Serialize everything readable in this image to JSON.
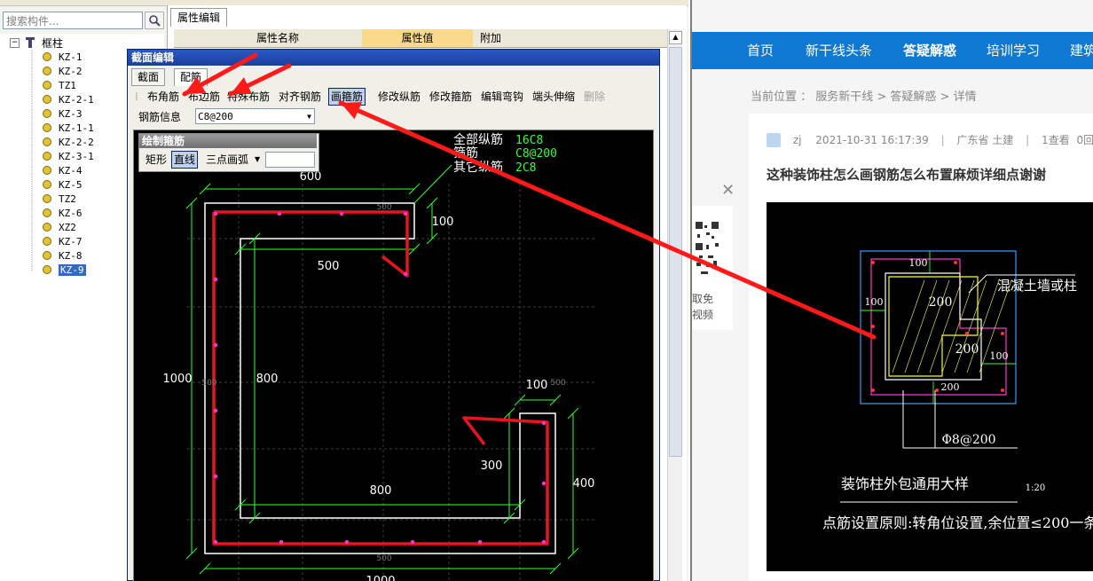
{
  "left_app": {
    "search_placeholder": "搜索构件...",
    "tree_root": "框柱",
    "tree_items": [
      "KZ-1",
      "KZ-2",
      "TZ1",
      "KZ-2-1",
      "KZ-3",
      "KZ-1-1",
      "KZ-2-2",
      "KZ-3-1",
      "KZ-4",
      "KZ-5",
      "TZ2",
      "KZ-6",
      "XZ2",
      "KZ-7",
      "KZ-8",
      "KZ-9"
    ],
    "selected_item": "KZ-9",
    "prop_tab": "属性编辑",
    "prop_col_name": "属性名称",
    "prop_col_value": "属性值",
    "prop_col_extra": "附加"
  },
  "dialog": {
    "title": "截面编辑",
    "tabs": [
      "截面",
      "配筋"
    ],
    "toolbar": [
      "布角筋",
      "布边筋",
      "特殊布筋",
      "对齐钢筋",
      "画箍筋",
      "修改纵筋",
      "修改箍筋",
      "编辑弯钩",
      "端头伸缩",
      "删除"
    ],
    "active_tool": "画箍筋",
    "rebar_info_label": "钢筋信息",
    "rebar_info_value": "C8@200",
    "draw_panel_title": "绘制箍筋",
    "draw_modes": [
      "矩形",
      "直线",
      "三点画弧"
    ],
    "active_mode": "直线",
    "legend_labels": [
      "全部纵筋",
      "箍筋",
      "其它纵筋"
    ],
    "legend_values": [
      "16C8",
      "C8@200",
      "2C8"
    ],
    "dims": [
      "600",
      "100",
      "500",
      "1000",
      "800",
      "100",
      "300",
      "800",
      "400",
      "1000"
    ],
    "faint_dims": [
      "500",
      "500",
      "500",
      "500"
    ]
  },
  "web": {
    "nav": [
      "首页",
      "新干线头条",
      "答疑解惑",
      "培训学习",
      "建筑"
    ],
    "active_nav": "答疑解惑",
    "breadcrumb": "当前位置 ： 服务新干线 > 答疑解惑 > 详情",
    "qr_caption_1": "取免",
    "qr_caption_2": "视频",
    "meta_user": "zj",
    "meta_time": "2021-10-31 16:17:39",
    "meta_region": "广东省  土建",
    "meta_views": "1查看",
    "meta_replies": "0回",
    "title": "这种装饰柱怎么画钢筋怎么布置麻烦详细点谢谢",
    "cad_labels": {
      "wall": "混凝土墙或柱",
      "d100a": "100",
      "d100b": "100",
      "d100c": "100",
      "d200a": "200",
      "d200b": "200",
      "d200c": "200",
      "stirrup": "Φ8@200",
      "detail": "装饰柱外包通用大样",
      "scale": "1:20",
      "note": "点筋设置原则:转角位设置,余位置≤200一条。"
    }
  },
  "colors": {
    "nav_blue": "#0f78d2",
    "annotation_red": "#ff1a1a",
    "stirrup_red": "#e8141e",
    "dim_green": "#33ff33",
    "outline_white": "#ffffff",
    "rebar_magenta": "#ff33cc"
  }
}
